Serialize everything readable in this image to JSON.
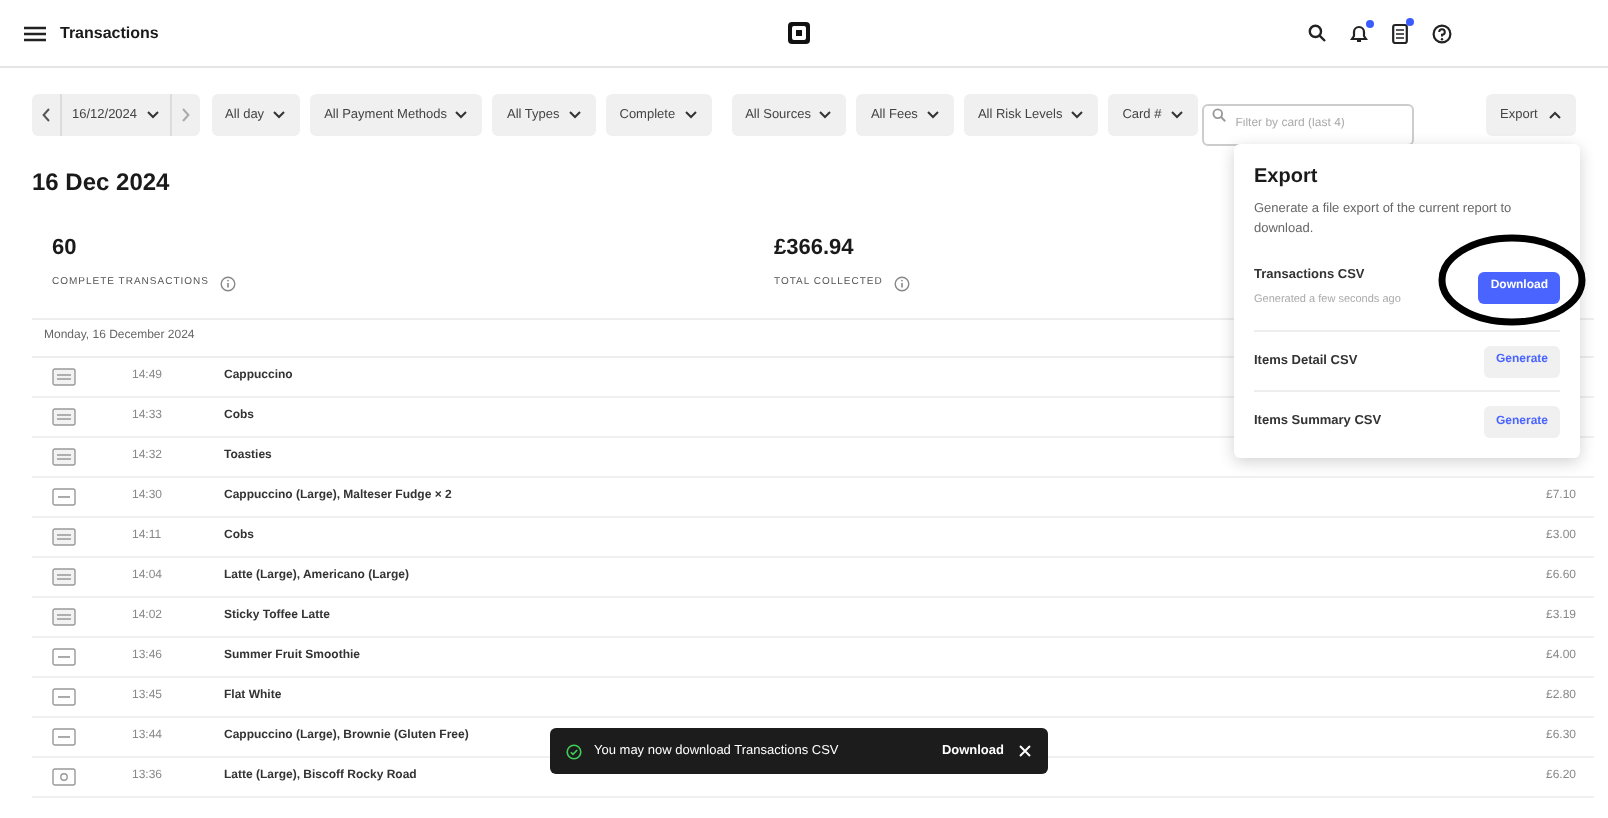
{
  "header": {
    "title": "Transactions",
    "notifications_badge": true,
    "clipboard_badge": true
  },
  "filters": {
    "date": "16/12/2024",
    "chips": [
      "All day",
      "All Payment Methods",
      "All Types",
      "Complete",
      "All Sources",
      "All Fees",
      "All Risk Levels",
      "Card #"
    ],
    "search_placeholder": "Filter by card (last 4)",
    "export": "Export",
    "export_expanded": true
  },
  "page_title": "16 Dec 2024",
  "stats": [
    {
      "value": "60",
      "label": "COMPLETE TRANSACTIONS"
    },
    {
      "value": "£366.94",
      "label": "TOTAL COLLECTED"
    }
  ],
  "day_heading": "Monday, 16 December 2024",
  "rows": [
    {
      "kind": "chip",
      "time": "14:49",
      "items": "Cappuccino"
    },
    {
      "kind": "chip",
      "time": "14:33",
      "items": "Cobs"
    },
    {
      "kind": "chip",
      "time": "14:32",
      "items": "Toasties"
    },
    {
      "kind": "visa",
      "time": "14:30",
      "items": "Cappuccino (Large), Malteser Fudge × 2",
      "amount": "£7.10"
    },
    {
      "kind": "chip",
      "time": "14:11",
      "items": "Cobs",
      "amount": "£3.00"
    },
    {
      "kind": "chip",
      "time": "14:04",
      "items": "Latte (Large), Americano (Large)",
      "amount": "£6.60"
    },
    {
      "kind": "chip",
      "time": "14:02",
      "items": "Sticky Toffee Latte",
      "amount": "£3.19"
    },
    {
      "kind": "visa",
      "time": "13:46",
      "items": "Summer Fruit Smoothie",
      "amount": "£4.00"
    },
    {
      "kind": "visa",
      "time": "13:45",
      "items": "Flat White",
      "amount": "£2.80"
    },
    {
      "kind": "visa",
      "time": "13:44",
      "items": "Cappuccino (Large), Brownie (Gluten Free)",
      "amount": "£6.30"
    },
    {
      "kind": "reader",
      "time": "13:36",
      "items": "Latte (Large), Biscoff Rocky Road",
      "amount": "£6.20"
    }
  ],
  "export_popup": {
    "title": "Export",
    "description": "Generate a file export of the current report to download.",
    "files": [
      {
        "name": "Transactions CSV",
        "note": "Generated a few seconds ago",
        "action": "Download",
        "kind": "ready"
      },
      {
        "name": "Items Detail CSV",
        "action": "Generate",
        "kind": "pending"
      },
      {
        "name": "Items Summary CSV",
        "action": "Generate",
        "kind": "pending"
      }
    ]
  },
  "toast": {
    "message": "You may now download Transactions CSV",
    "action": "Download"
  }
}
